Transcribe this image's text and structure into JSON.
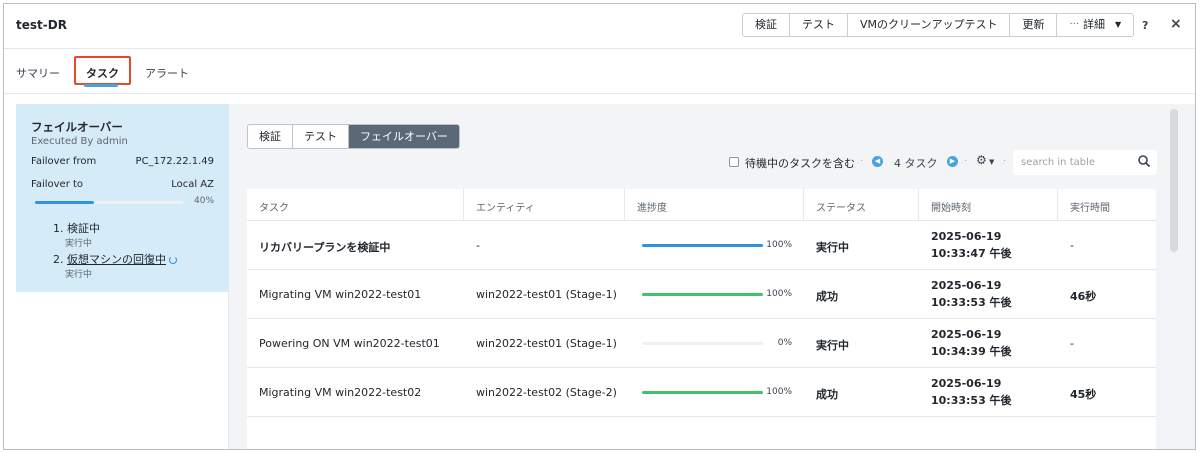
{
  "window": {
    "title": "test-DR"
  },
  "header": {
    "buttons": [
      "検証",
      "テスト",
      "VMのクリーンアップテスト",
      "更新"
    ],
    "more_dots": "···",
    "more_label": "詳細",
    "help": "?",
    "close": "×"
  },
  "tabs": [
    {
      "label": "サマリー"
    },
    {
      "label": "タスク"
    },
    {
      "label": "アラート"
    }
  ],
  "summary": {
    "title": "フェイルオーバー",
    "executed_by": "Executed By admin",
    "failover_from_label": "Failover from",
    "failover_from_value": "PC_172.22.1.49",
    "failover_to_label": "Failover to",
    "failover_to_value": "Local AZ",
    "progress_fraction": 0.4,
    "progress_label": "40%",
    "steps": [
      {
        "label": "1. 検証中",
        "status": "実行中"
      },
      {
        "num": "2.",
        "label": "仮想マシンの回復中",
        "status": "実行中"
      }
    ]
  },
  "filter_tabs": [
    "検証",
    "テスト",
    "フェイルオーバー"
  ],
  "toolbar": {
    "include_pending_label": "待機中のタスクを含む",
    "count_label": "4 タスク",
    "search_placeholder": "search in table"
  },
  "table": {
    "columns": [
      "タスク",
      "エンティティ",
      "進捗度",
      "ステータス",
      "開始時刻",
      "実行時間"
    ],
    "rows": [
      {
        "task": "リカバリープランを検証中",
        "entity": "-",
        "progress": 1.0,
        "progress_label": "100%",
        "progress_color": "#2f93e0",
        "status": "実行中",
        "start": "2025-06-19 10:33:47 午後",
        "duration": "-"
      },
      {
        "task": "Migrating VM win2022-test01",
        "entity": "win2022-test01 (Stage-1)",
        "progress": 1.0,
        "progress_label": "100%",
        "progress_color": "#3ec26a",
        "status": "成功",
        "start": "2025-06-19 10:33:53 午後",
        "duration": "46秒"
      },
      {
        "task": "Powering ON VM win2022-test01",
        "entity": "win2022-test01 (Stage-1)",
        "progress": 0.0,
        "progress_label": "0%",
        "progress_color": "#2f93e0",
        "status": "実行中",
        "start": "2025-06-19 10:34:39 午後",
        "duration": "-"
      },
      {
        "task": "Migrating VM win2022-test02",
        "entity": "win2022-test02 (Stage-2)",
        "progress": 1.0,
        "progress_label": "100%",
        "progress_color": "#3ec26a",
        "status": "成功",
        "start": "2025-06-19 10:33:53 午後",
        "duration": "45秒"
      }
    ]
  }
}
